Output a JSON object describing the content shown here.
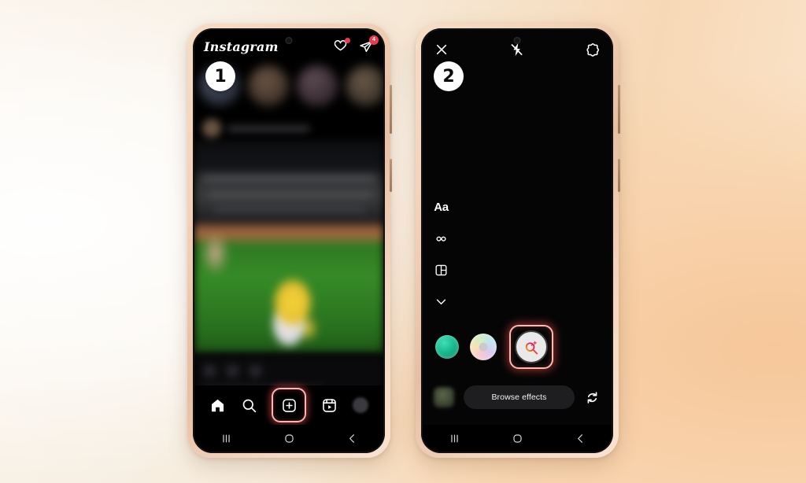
{
  "background": {
    "gradient_from": "#faf3e9",
    "gradient_to": "#f7d8b6",
    "accent_peach": "#f6c79a"
  },
  "highlight_color": "#ffb3b3",
  "steps": [
    {
      "number": "1",
      "screen": "instagram-home-feed"
    },
    {
      "number": "2",
      "screen": "instagram-story-camera"
    }
  ],
  "phone1": {
    "badge": "1",
    "topbar": {
      "logo": "Instagram",
      "heart_icon": "heart-icon",
      "heart_has_dot": true,
      "messenger_icon": "messenger-send-icon",
      "messenger_badge": "4"
    },
    "feed": {
      "stories_label": "stories-tray",
      "post_label": "blurred-feed-post",
      "media_label": "baseball-field-photo"
    },
    "tabbar": {
      "items": [
        {
          "name": "home-tab",
          "icon": "home-icon"
        },
        {
          "name": "search-tab",
          "icon": "search-icon"
        },
        {
          "name": "create-tab",
          "icon": "plus-square-icon",
          "highlighted": true
        },
        {
          "name": "reels-tab",
          "icon": "reels-icon"
        },
        {
          "name": "profile-tab",
          "icon": "avatar"
        }
      ]
    },
    "android_nav": {
      "recents": "recents-icon",
      "home": "home-circle-icon",
      "back": "back-chevron-icon"
    }
  },
  "phone2": {
    "badge": "2",
    "topbar": {
      "close_icon": "close-x-icon",
      "flash_icon": "flash-off-icon",
      "settings_icon": "camera-settings-icon"
    },
    "tools": [
      {
        "name": "text-tool",
        "label": "Aa"
      },
      {
        "name": "boomerang-tool",
        "icon": "infinity-icon"
      },
      {
        "name": "layout-tool",
        "icon": "layout-grid-icon"
      },
      {
        "name": "more-tools",
        "icon": "chevron-down-icon"
      }
    ],
    "effects": [
      {
        "name": "effect-thumb-green",
        "selected": false
      },
      {
        "name": "effect-thumb-rainbow",
        "selected": false
      },
      {
        "name": "effect-browse-search",
        "selected": true,
        "icon": "magnifier-sparkle-icon"
      }
    ],
    "bottom": {
      "gallery_thumb": "gallery-thumbnail",
      "browse_effects_label": "Browse effects",
      "flip_camera_icon": "flip-camera-icon"
    },
    "android_nav": {
      "recents": "recents-icon",
      "home": "home-circle-icon",
      "back": "back-chevron-icon"
    }
  }
}
